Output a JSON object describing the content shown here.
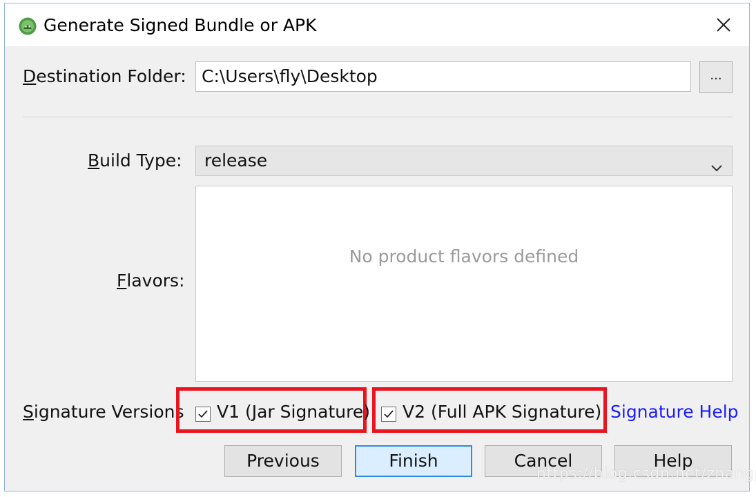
{
  "dialog": {
    "title": "Generate Signed Bundle or APK",
    "close_icon": "close-icon",
    "app_icon": "android-studio-icon"
  },
  "destination": {
    "label": "Destination Folder:",
    "value": "C:\\Users\\fly\\Desktop",
    "browse_label": "..."
  },
  "build_type": {
    "label": "Build Type:",
    "value": "release"
  },
  "flavors": {
    "label": "Flavors:",
    "empty_text": "No product flavors defined"
  },
  "signature": {
    "label": "Signature Versions",
    "v1_label": "V1 (Jar Signature)",
    "v1_checked": true,
    "v2_label": "V2 (Full APK Signature)",
    "v2_checked": true,
    "help_link": "Signature Help",
    "highlight_color": "#e8141f"
  },
  "buttons": {
    "previous": "Previous",
    "finish": "Finish",
    "cancel": "Cancel",
    "help": "Help"
  },
  "watermark": "https://blog.csdn.net/zhangphil",
  "colors": {
    "link": "#1a1aff",
    "primary_button_border": "#2f8ae0"
  }
}
